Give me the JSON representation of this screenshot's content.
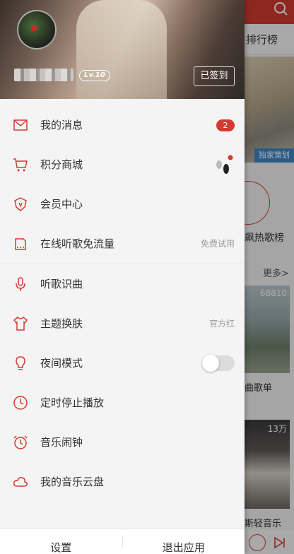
{
  "background_app": {
    "tab_label": "排行榜",
    "banner_tag": "独家策划",
    "hot_label": "飙热歌榜",
    "more_label": "更多>",
    "card1_count": "68810",
    "card1_label": "曲歌单",
    "card2_count": "13万",
    "card2_label": "斯轻音乐",
    "colors": {
      "brand_red": "#d33a31"
    }
  },
  "drawer": {
    "header": {
      "level": "Lv.10",
      "signin_label": "已签到"
    },
    "menu": [
      {
        "label": "我的消息",
        "icon": "mail-icon",
        "badge": "2"
      },
      {
        "label": "积分商城",
        "icon": "cart-icon"
      },
      {
        "label": "会员中心",
        "icon": "vip-shield-icon"
      },
      {
        "label": "在线听歌免流量",
        "icon": "sim-card-icon",
        "right": "免费试用"
      },
      {
        "label": "听歌识曲",
        "icon": "mic-icon"
      },
      {
        "label": "主题换肤",
        "icon": "tshirt-icon",
        "right": "官方红"
      },
      {
        "label": "夜间模式",
        "icon": "bulb-icon",
        "toggle": false
      },
      {
        "label": "定时停止播放",
        "icon": "clock-icon"
      },
      {
        "label": "音乐闹钟",
        "icon": "alarm-clock-icon"
      },
      {
        "label": "我的音乐云盘",
        "icon": "cloud-icon"
      }
    ],
    "footer": {
      "settings_label": "设置",
      "exit_label": "退出应用"
    }
  }
}
